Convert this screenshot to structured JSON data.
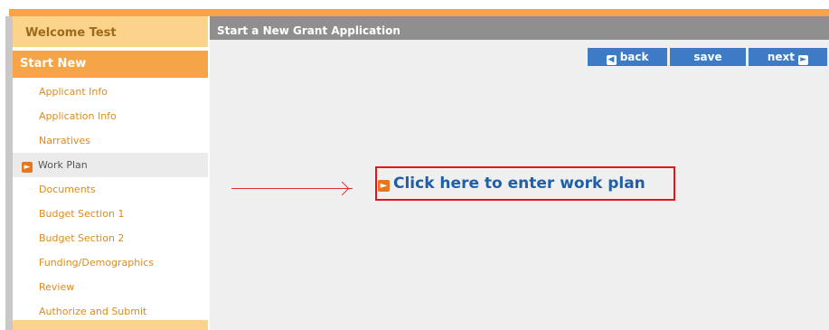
{
  "sidebar": {
    "welcome": "Welcome Test",
    "section_title": "Start New",
    "items": [
      {
        "label": "Applicant Info"
      },
      {
        "label": "Application Info"
      },
      {
        "label": "Narratives"
      },
      {
        "label": "Work Plan",
        "active": true
      },
      {
        "label": "Documents"
      },
      {
        "label": "Budget Section 1"
      },
      {
        "label": "Budget Section 2"
      },
      {
        "label": "Funding/Demographics"
      },
      {
        "label": "Review"
      },
      {
        "label": "Authorize and Submit"
      }
    ]
  },
  "main": {
    "header_title": "Start a New Grant Application",
    "buttons": {
      "back_label": "back",
      "save_label": "save",
      "next_label": "next"
    },
    "link_label": "Click here to enter work plan"
  },
  "colors": {
    "accent_orange": "#f5a447",
    "light_orange": "#fcd38a",
    "button_blue": "#3d7cc4",
    "link_blue": "#1f5fa8",
    "highlight_red": "#e0141e"
  },
  "icons": {
    "active_item_icon": "arrow-right-icon",
    "back_icon": "arrow-left-icon",
    "next_icon": "arrow-right-icon",
    "link_icon": "arrow-right-icon"
  }
}
